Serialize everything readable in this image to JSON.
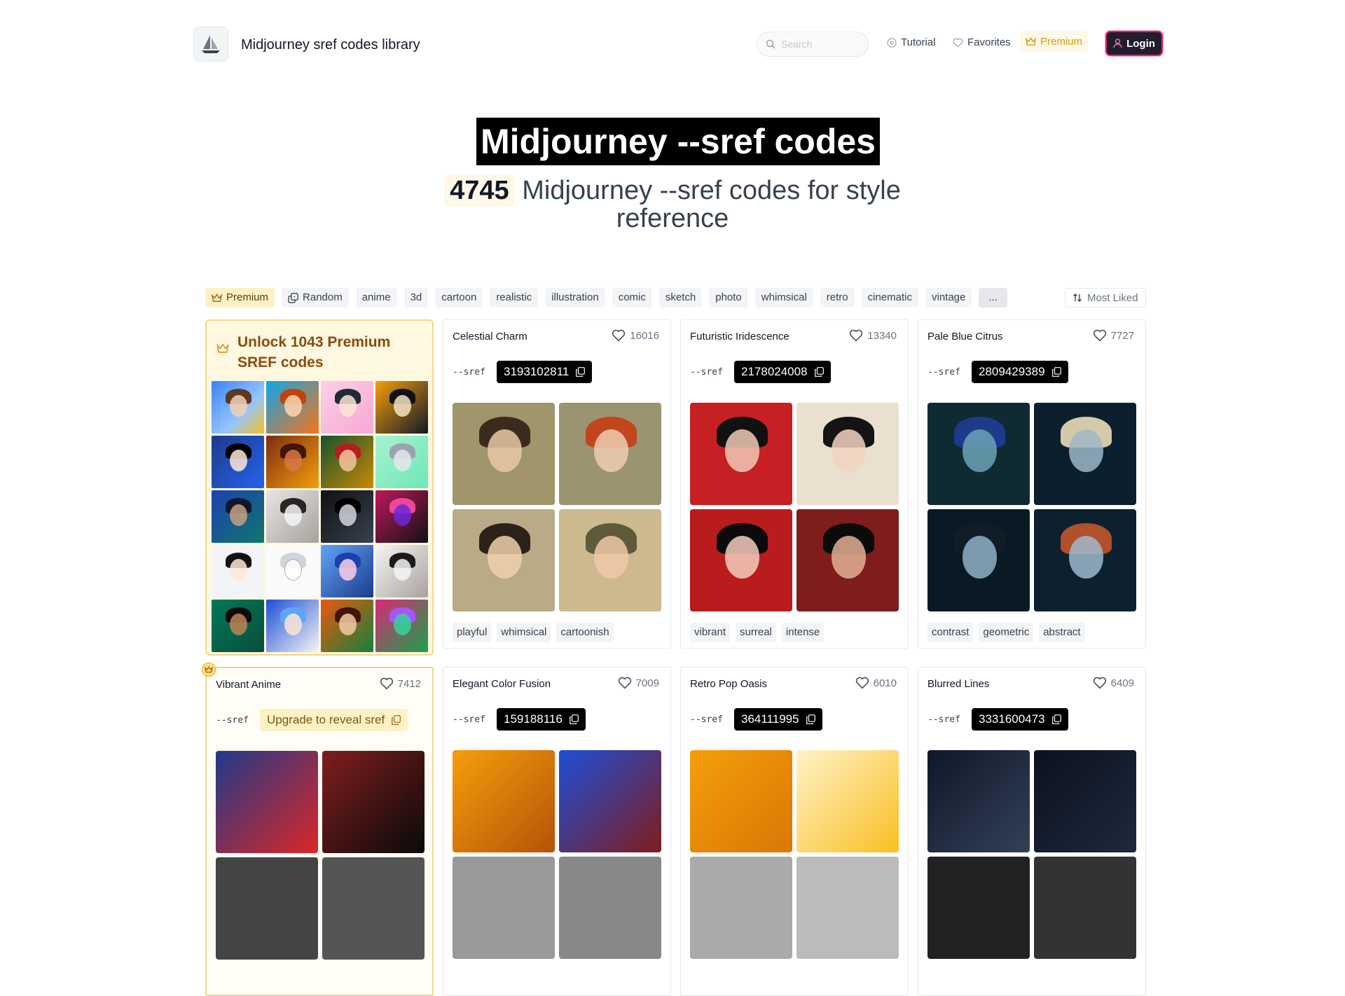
{
  "header": {
    "site_title": "Midjourney sref codes library",
    "search_placeholder": "Search",
    "nav": {
      "tutorial": "Tutorial",
      "favorites": "Favorites",
      "premium": "Premium",
      "login": "Login"
    }
  },
  "hero": {
    "title": "Midjourney --sref codes",
    "count": "4745",
    "subtitle": "Midjourney --sref codes for style reference"
  },
  "tagbar": {
    "premium": "Premium",
    "random": "Random",
    "tags": [
      "anime",
      "3d",
      "cartoon",
      "realistic",
      "illustration",
      "comic",
      "sketch",
      "photo",
      "whimsical",
      "retro",
      "cinematic",
      "vintage",
      "..."
    ],
    "sort": "Most Liked"
  },
  "promo": {
    "title": "Unlock 1043 Premium SREF codes"
  },
  "sref_label": "--sref",
  "cards": [
    {
      "title": "Celestial Charm",
      "likes": "16016",
      "code": "3193102811",
      "tags": [
        "playful",
        "whimsical",
        "cartoonish"
      ]
    },
    {
      "title": "Futuristic Iridescence",
      "likes": "13340",
      "code": "2178024008",
      "tags": [
        "vibrant",
        "surreal",
        "intense"
      ]
    },
    {
      "title": "Pale Blue Citrus",
      "likes": "7727",
      "code": "2809429389",
      "tags": [
        "contrast",
        "geometric",
        "abstract"
      ]
    },
    {
      "title": "Vibrant Anime",
      "likes": "7412",
      "code": "Upgrade to reveal sref",
      "tags": []
    },
    {
      "title": "Elegant Color Fusion",
      "likes": "7009",
      "code": "159188116",
      "tags": []
    },
    {
      "title": "Retro Pop Oasis",
      "likes": "6010",
      "code": "364111995",
      "tags": []
    },
    {
      "title": "Blurred Lines",
      "likes": "6409",
      "code": "3331600473",
      "tags": []
    }
  ],
  "colors": {
    "accent_premium": "#d49a0c",
    "login_border": "#e2246c",
    "promo_bg": "#fff8e1"
  }
}
